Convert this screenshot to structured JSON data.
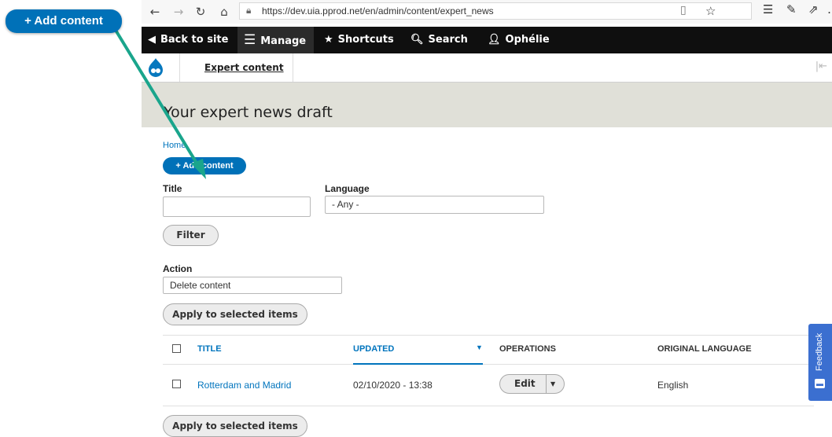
{
  "browser": {
    "url": "https://dev.uia.pprod.net/en/admin/content/expert_news"
  },
  "toolbar": {
    "back_label": "Back to site",
    "manage_label": "Manage",
    "shortcuts_label": "Shortcuts",
    "search_label": "Search",
    "user_label": "Ophélie"
  },
  "tray": {
    "link_label": "Expert content"
  },
  "page": {
    "title": "Your expert news draft",
    "breadcrumb": "Home",
    "add_content_label": "+ Add content"
  },
  "filters": {
    "title_label": "Title",
    "title_value": "",
    "language_label": "Language",
    "language_value": "- Any -",
    "filter_button": "Filter"
  },
  "bulk": {
    "action_label": "Action",
    "action_value": "Delete content",
    "apply_label": "Apply to selected items"
  },
  "table": {
    "headers": {
      "title": "TITLE",
      "updated": "UPDATED",
      "operations": "OPERATIONS",
      "original_language": "ORIGINAL LANGUAGE"
    },
    "rows": [
      {
        "title": "Rotterdam and Madrid",
        "updated": "02/10/2020 - 13:38",
        "operation": "Edit",
        "language": "English"
      }
    ]
  },
  "feedback": {
    "label": "Feedback"
  },
  "annotation": {
    "callout_label": "+ Add content",
    "color": "#1aa58c"
  },
  "colors": {
    "primary": "#0071b8",
    "link": "#0074bd",
    "toolbar_bg": "#0f0f0f",
    "header_bg": "#e0e0d8"
  }
}
